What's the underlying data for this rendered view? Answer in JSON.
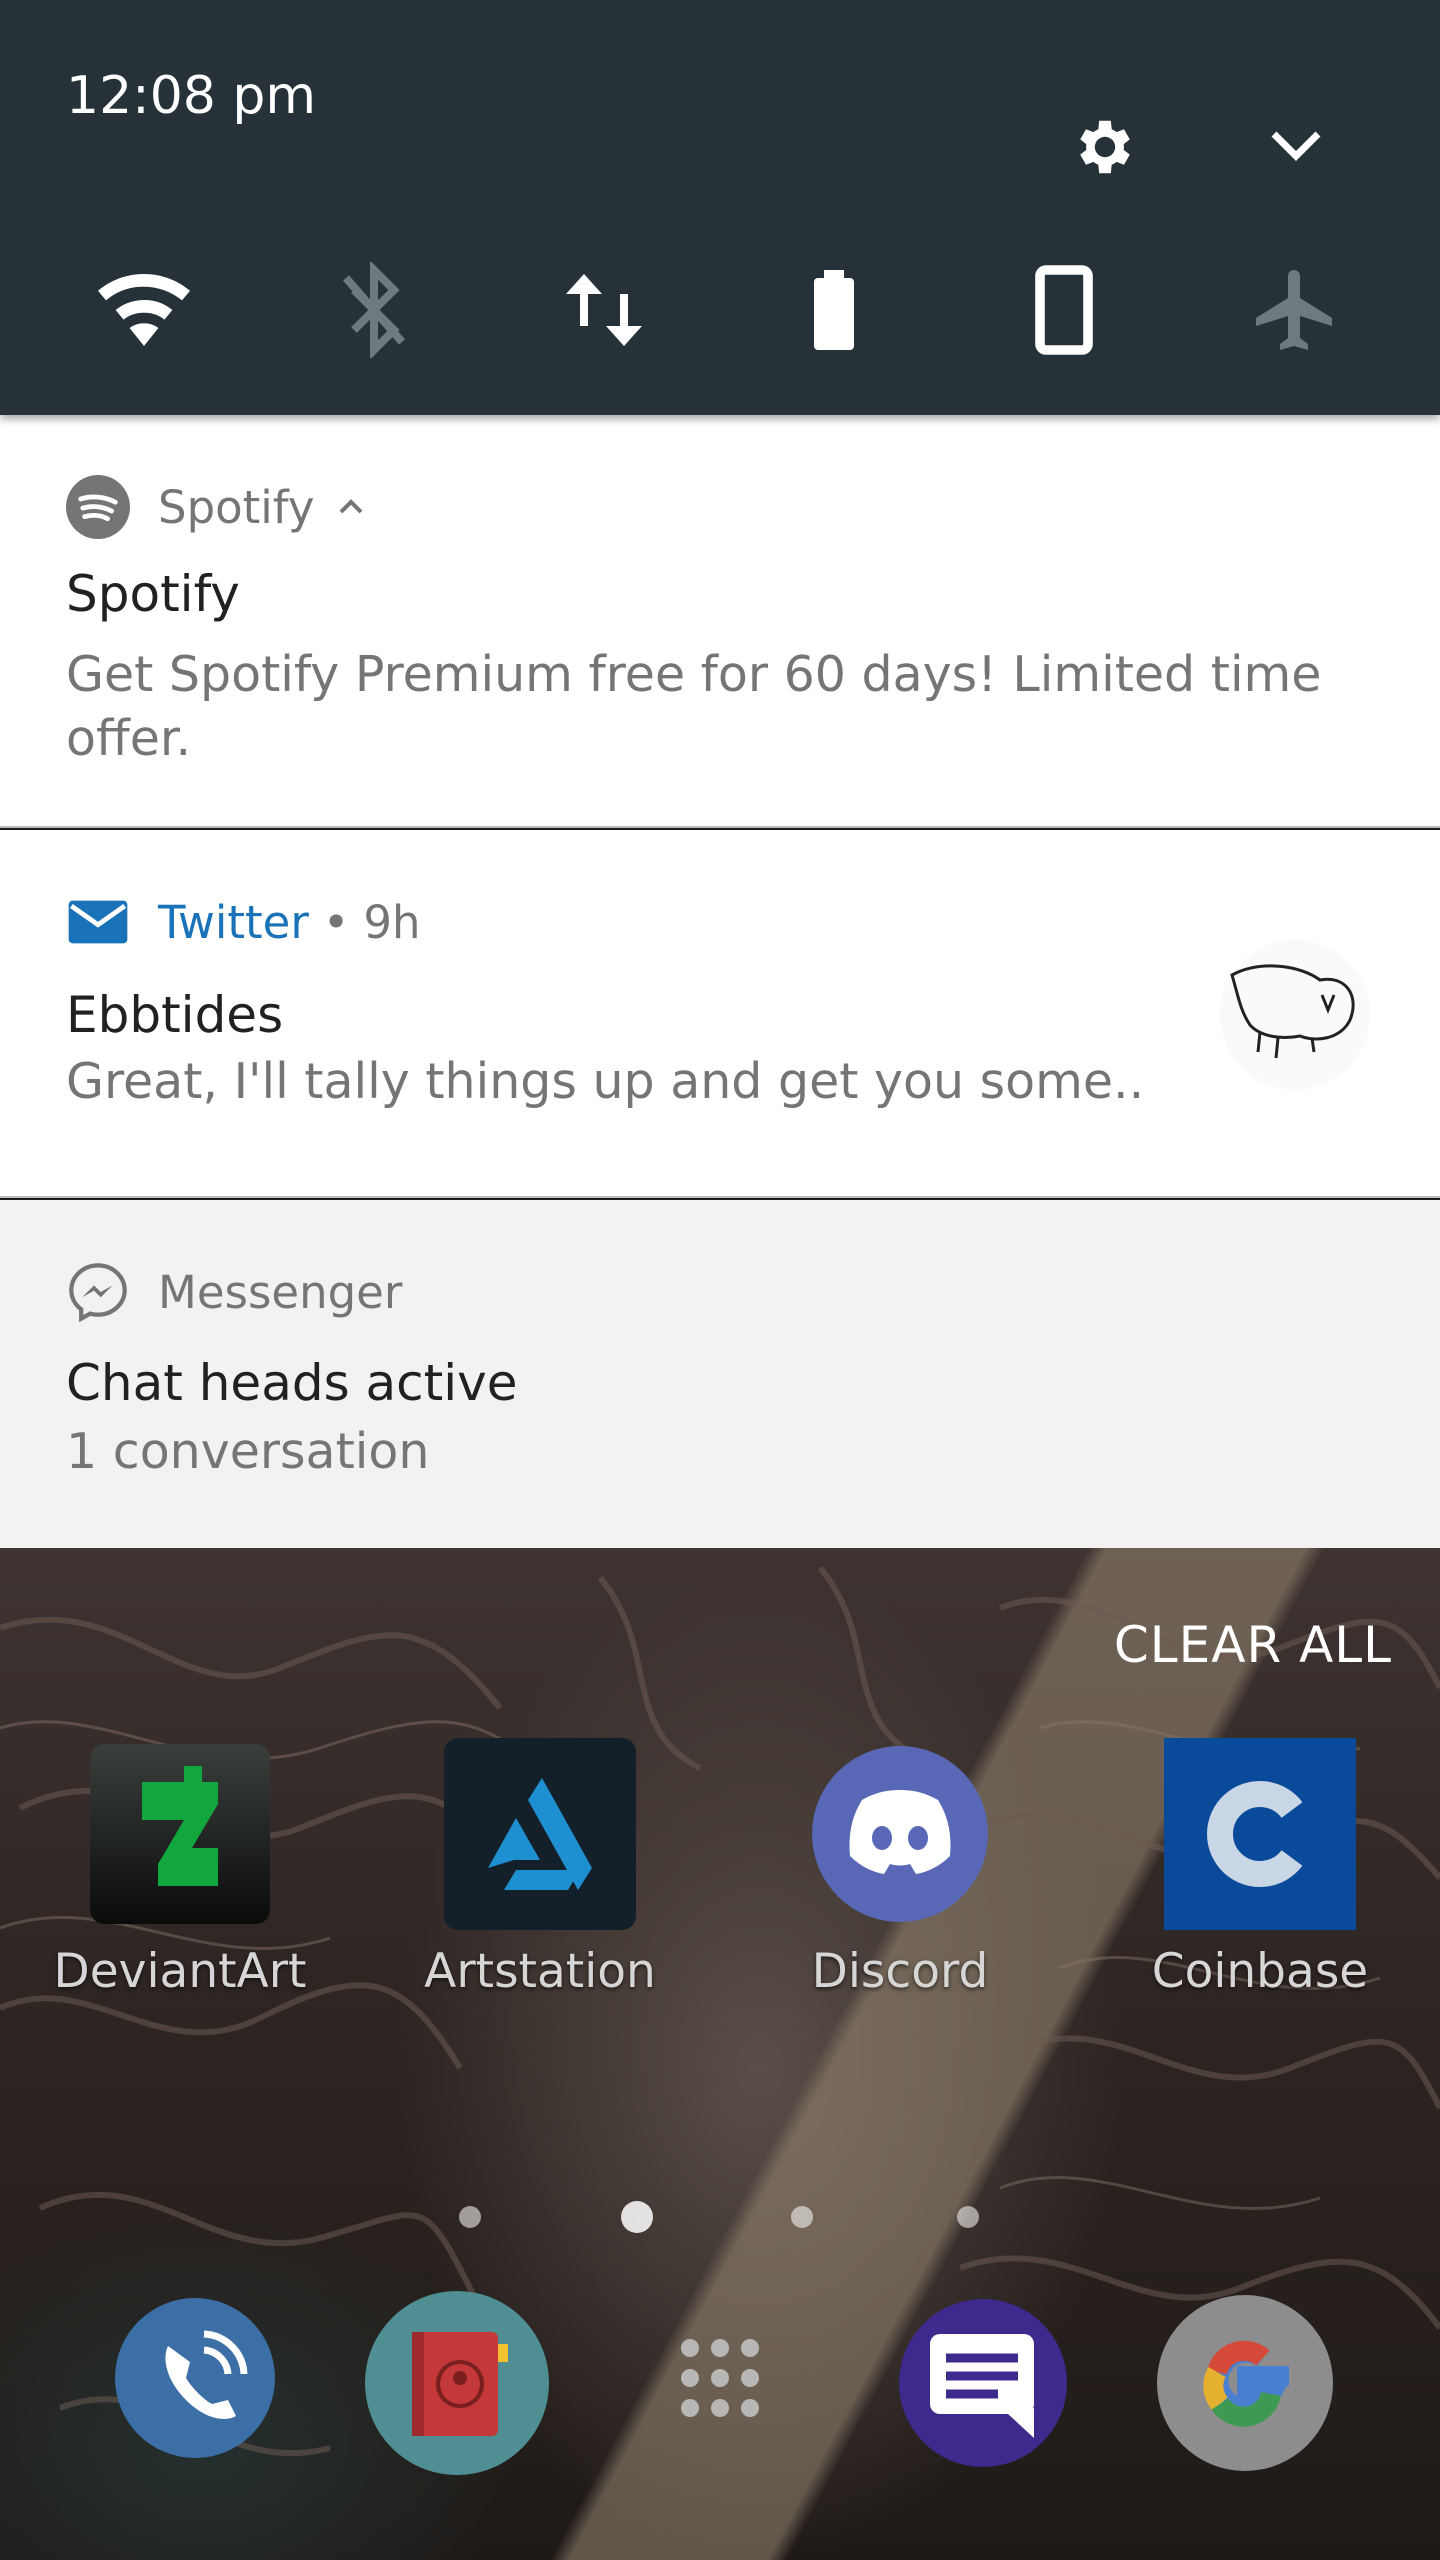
{
  "status": {
    "time": "12:08 pm"
  },
  "quick_settings": {
    "tiles": [
      {
        "icon": "wifi-icon",
        "state": "on"
      },
      {
        "icon": "bluetooth-off-icon",
        "state": "off"
      },
      {
        "icon": "mobile-data-icon",
        "state": "on"
      },
      {
        "icon": "battery-icon",
        "state": "on"
      },
      {
        "icon": "auto-rotate-icon",
        "state": "on"
      },
      {
        "icon": "airplane-mode-icon",
        "state": "off"
      }
    ]
  },
  "notifications": {
    "spotify": {
      "app": "Spotify",
      "title": "Spotify",
      "text": "Get Spotify Premium free for 60 days! Limited time offer."
    },
    "twitter": {
      "app": "Twitter",
      "separator": "•",
      "time": "9h",
      "title": "Ebbtides",
      "text": "Great, I'll tally things up and get you some.."
    },
    "messenger": {
      "app": "Messenger",
      "title": "Chat heads active",
      "text": "1 conversation"
    }
  },
  "home": {
    "clear_all": "CLEAR ALL",
    "apps": [
      {
        "label": "DeviantArt"
      },
      {
        "label": "Artstation"
      },
      {
        "label": "Discord"
      },
      {
        "label": "Coinbase"
      }
    ],
    "page_indicator": {
      "pages": 4,
      "current": 2
    },
    "dock": [
      "phone-icon",
      "contacts-icon",
      "app-drawer-icon",
      "messages-icon",
      "google-icon"
    ]
  },
  "colors": {
    "header_bg": "#263238",
    "twitter_blue": "#1a73b8",
    "notif_bg": "#ffffff",
    "messenger_bg": "#f2f2f2"
  }
}
